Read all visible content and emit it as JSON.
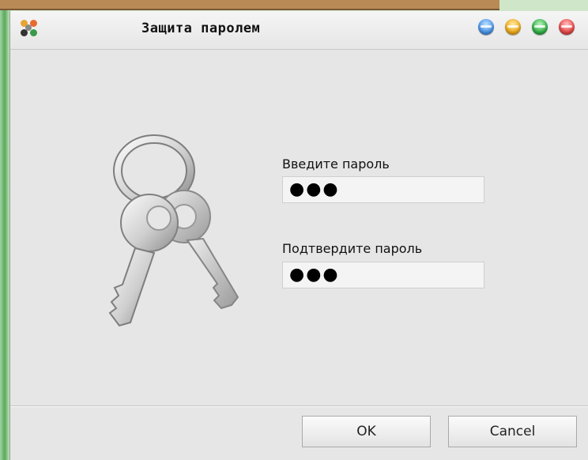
{
  "dialog": {
    "title": "Защита паролем",
    "window_buttons": [
      "minimize-button",
      "maximize-button",
      "restore-button",
      "close-button"
    ],
    "colors": {
      "blue": "#4f9bf0",
      "yellow": "#f5b21f",
      "green": "#35b84a",
      "red": "#ee4d4d"
    }
  },
  "form": {
    "password_label": "Введите пароль",
    "password_value": "●●●",
    "confirm_label": "Подтвердите пароль",
    "confirm_value": "●●●"
  },
  "buttons": {
    "ok_label": "OK",
    "cancel_label": "Cancel"
  },
  "icons": {
    "app": "app-icon",
    "keys": "keys-icon"
  }
}
